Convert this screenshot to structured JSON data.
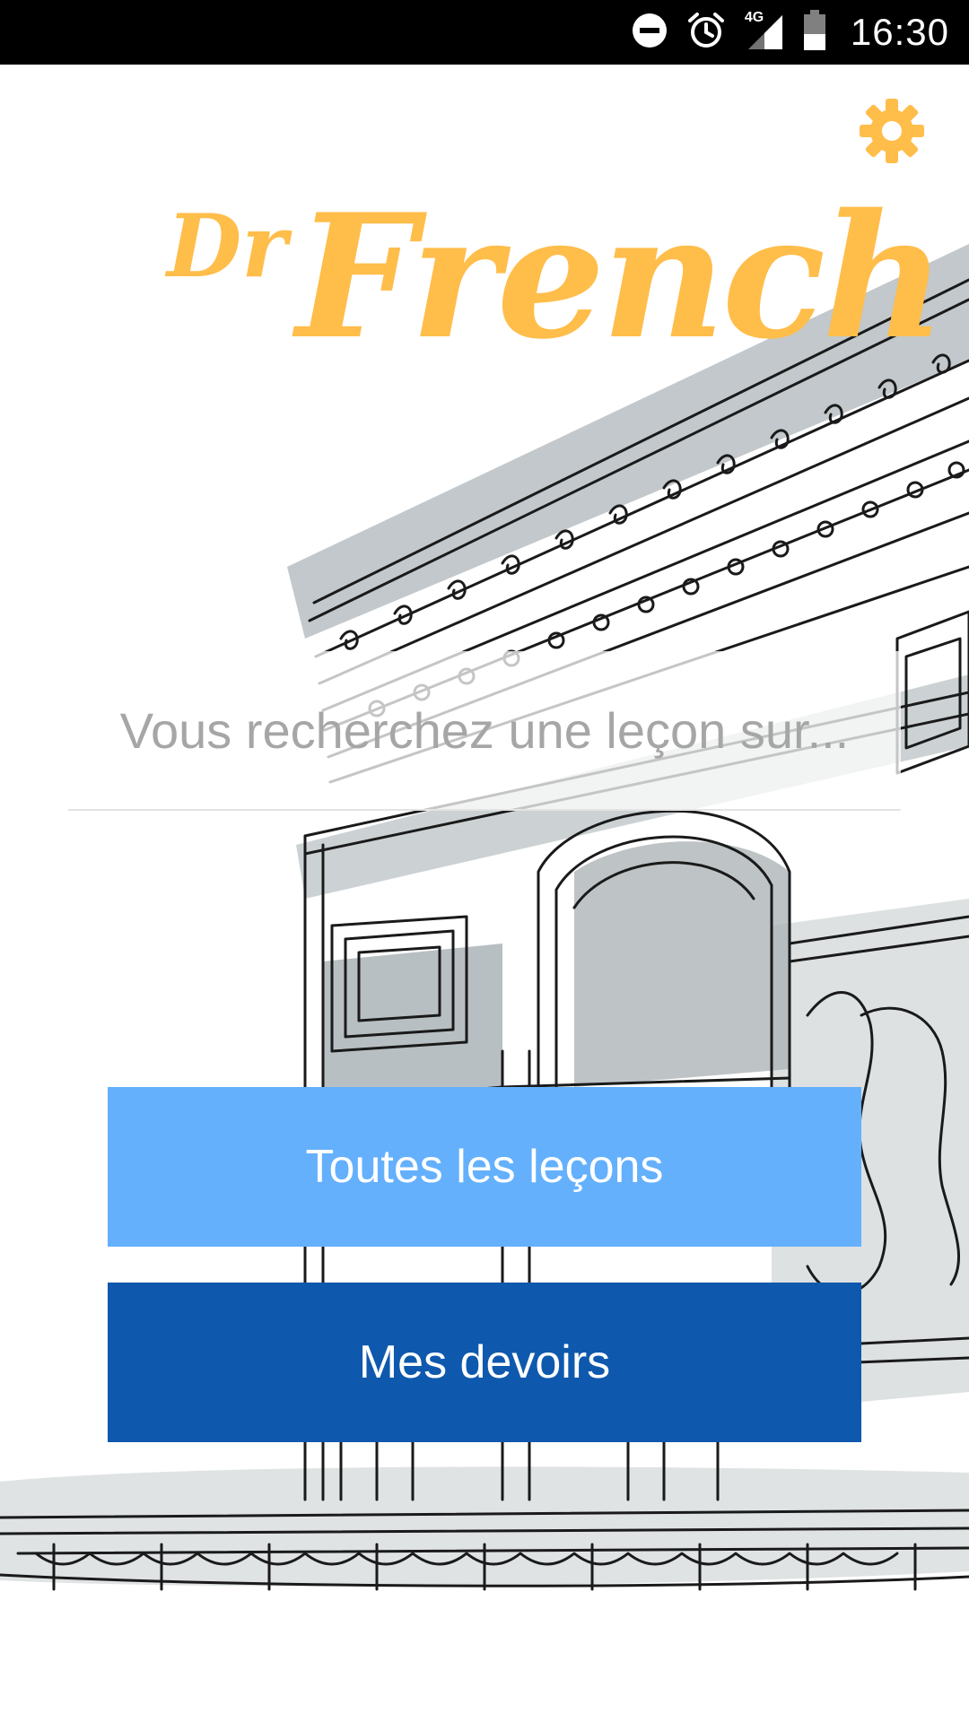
{
  "status_bar": {
    "time": "16:30",
    "network": "4G",
    "icons": [
      "do-not-disturb-icon",
      "alarm-icon",
      "signal-icon",
      "battery-icon"
    ]
  },
  "app": {
    "logo_prefix": "Dr",
    "logo_main": "French",
    "accent_color": "#ffbd4a"
  },
  "settings": {
    "icon": "gear-icon"
  },
  "search": {
    "placeholder": "Vous recherchez une leçon sur...",
    "value": ""
  },
  "buttons": {
    "all_lessons": {
      "label": "Toutes les leçons",
      "color": "#64b0fc"
    },
    "homework": {
      "label": "Mes devoirs",
      "color": "#0e59ad"
    }
  }
}
